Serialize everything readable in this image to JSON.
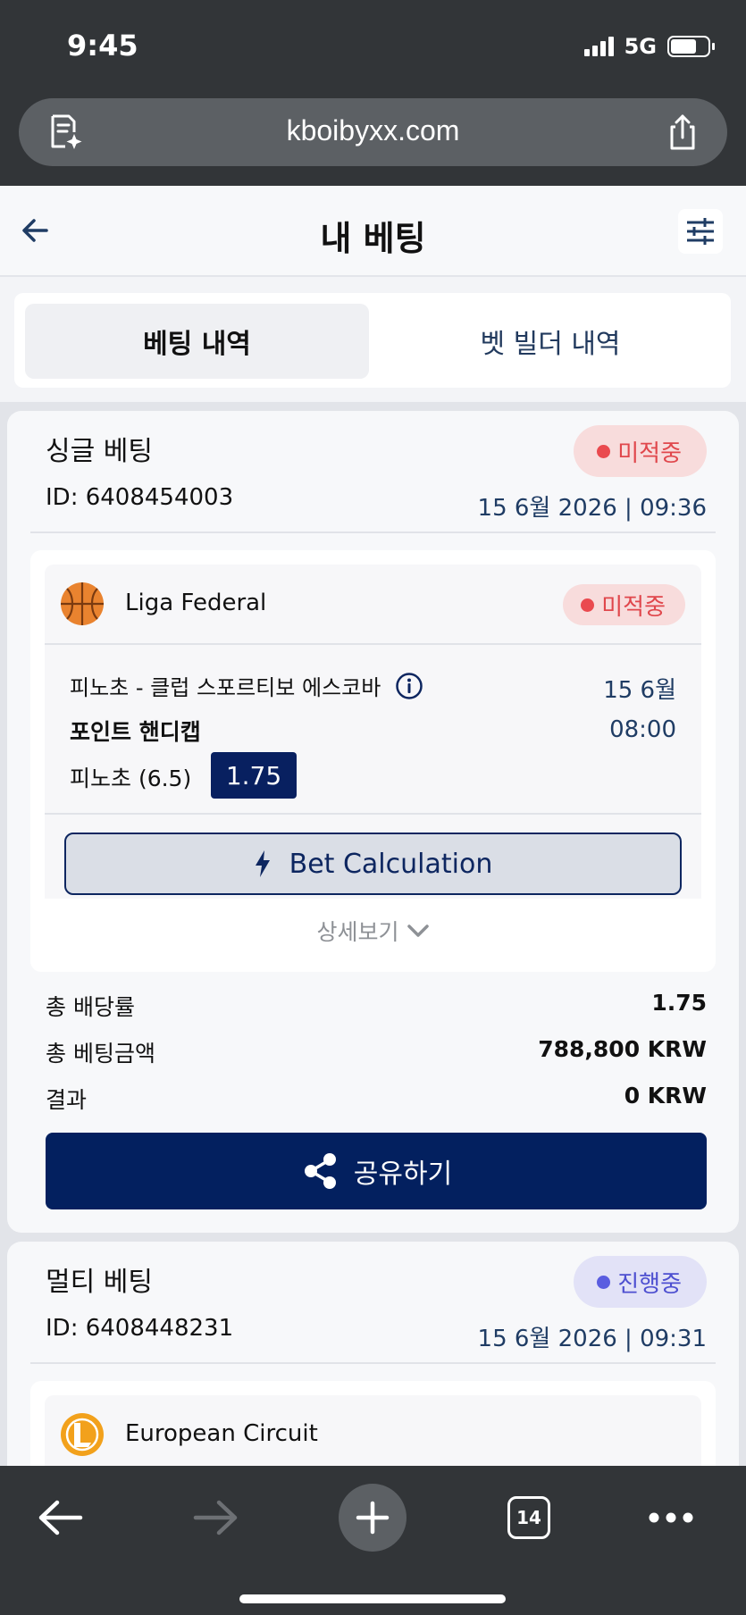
{
  "status_bar": {
    "time": "9:45",
    "network": "5G"
  },
  "browser": {
    "url": "kboibyxx.com",
    "tab_count": "14"
  },
  "header": {
    "title": "내 베팅"
  },
  "tabs": [
    {
      "label": "베팅 내역",
      "active": true
    },
    {
      "label": "벳 빌더 내역",
      "active": false
    }
  ],
  "bets": [
    {
      "type": "싱글 베팅",
      "status": "미적중",
      "id": "ID: 6408454003",
      "datetime": "15 6월 2026 | 09:36",
      "selection": {
        "league": "Liga Federal",
        "league_icon": "basketball-icon",
        "status": "미적중",
        "match": "피노초 - 클럽 스포르티보 에스코바",
        "date": "15 6월",
        "market": "포인트 핸디캡",
        "time": "08:00",
        "pick": "피노초 (6.5)",
        "odds": "1.75"
      },
      "calc_label": "Bet Calculation",
      "details_label": "상세보기",
      "summary": [
        {
          "label": "총 배당률",
          "value": "1.75"
        },
        {
          "label": "총 베팅금액",
          "value": "788,800 KRW"
        },
        {
          "label": "결과",
          "value": "0 KRW"
        }
      ],
      "share_label": "공유하기"
    },
    {
      "type": "멀티 베팅",
      "status": "진행중",
      "id": "ID: 6408448231",
      "datetime": "15 6월 2026 | 09:31",
      "selection": {
        "league": "European Circuit",
        "league_icon": "league-of-legends-icon"
      }
    }
  ],
  "colors": {
    "navy": "#03205f",
    "lose_red": "#ea4a4f",
    "live_purple": "#5a5de0",
    "basketball_orange": "#e9832f",
    "lol_orange": "#f2a11c"
  }
}
